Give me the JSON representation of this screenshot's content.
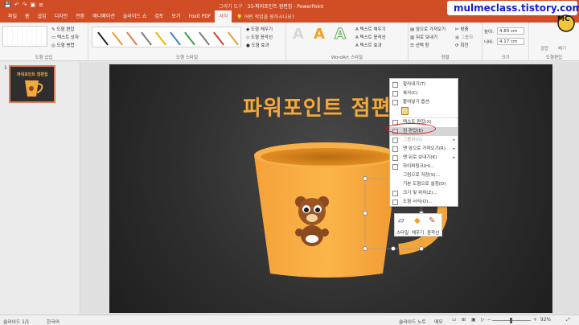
{
  "titlebar": {
    "context_tool": "그리기 도구",
    "doc_title": "33-파워포인트 점편집 - PowerPoint",
    "qat": [
      "💾",
      "↶",
      "↷",
      "▣",
      "≡"
    ]
  },
  "tabs": [
    {
      "label": "파일",
      "active": false
    },
    {
      "label": "홈",
      "active": false
    },
    {
      "label": "삽입",
      "active": false
    },
    {
      "label": "디자인",
      "active": false
    },
    {
      "label": "전환",
      "active": false
    },
    {
      "label": "애니메이션",
      "active": false
    },
    {
      "label": "슬라이드 쇼",
      "active": false
    },
    {
      "label": "검토",
      "active": false
    },
    {
      "label": "보기",
      "active": false
    },
    {
      "label": "Foxit PDF",
      "active": false
    },
    {
      "label": "서식",
      "active": true
    }
  ],
  "tell_me": "어떤 작업을 원하시나요?",
  "ribbon": {
    "insert_shapes": {
      "label": "도형 삽입",
      "edit_shape": "도형 편집",
      "text_box": "텍스트 상자",
      "merge_shapes": "도형 병합"
    },
    "shape_styles": {
      "label": "도형 스타일",
      "fill": "도형 채우기",
      "outline": "도형 윤곽선",
      "effects": "도형 효과",
      "swatch_colors": [
        "#222222",
        "#e69a2e",
        "#e07b3c",
        "#7d7d7d",
        "#f0b400",
        "#4a7fc1",
        "#3aa04a",
        "#7d7d7d",
        "#c44536",
        "#e0a030"
      ]
    },
    "wordart": {
      "label": "WordArt 스타일",
      "text_fill": "텍스트 채우기",
      "text_outline": "텍스트 윤곽선",
      "text_effects": "텍스트 효과",
      "sample_letter": "A"
    },
    "arrange": {
      "label": "정렬",
      "bring_forward": "앞으로 가져오기",
      "send_backward": "뒤로 보내기",
      "selection_pane": "선택 창",
      "align": "맞춤",
      "group": "그룹화",
      "rotate": "회전"
    },
    "size": {
      "label": "크기",
      "height_label": "높이:",
      "height_value": "4.83 cm",
      "width_label": "너비:",
      "width_value": "4.17 cm"
    },
    "shape_edit": {
      "label": "도형편집",
      "merge": "결합",
      "subtract": "빼기"
    }
  },
  "watermark": "mulmeclass.tistory.com",
  "thumbnails": [
    {
      "number": "1",
      "title": "파워포인트 점편집"
    }
  ],
  "slide": {
    "title": "파워포인트 점편"
  },
  "context_menu": [
    {
      "label": "잘라내기(T)",
      "enabled": true,
      "has_submenu": false,
      "highlighted": false
    },
    {
      "label": "복사(C)",
      "enabled": true,
      "has_submenu": false,
      "highlighted": false
    },
    {
      "label": "붙여넣기 옵션:",
      "enabled": true,
      "has_submenu": false,
      "highlighted": false
    },
    {
      "label": "텍스트 편집(X)",
      "enabled": true,
      "has_submenu": false,
      "highlighted": false
    },
    {
      "label": "점 편집(E)",
      "enabled": true,
      "has_submenu": false,
      "highlighted": true
    },
    {
      "label": "그룹화(G)",
      "enabled": false,
      "has_submenu": true,
      "highlighted": false
    },
    {
      "label": "맨 앞으로 가져오기(R)",
      "enabled": true,
      "has_submenu": true,
      "highlighted": false
    },
    {
      "label": "맨 뒤로 보내기(K)",
      "enabled": true,
      "has_submenu": true,
      "highlighted": false
    },
    {
      "label": "하이퍼링크(H)...",
      "enabled": true,
      "has_submenu": false,
      "highlighted": false
    },
    {
      "label": "그림으로 저장(S)...",
      "enabled": true,
      "has_submenu": false,
      "highlighted": false
    },
    {
      "label": "기본 도형으로 설정(D)",
      "enabled": true,
      "has_submenu": false,
      "highlighted": false
    },
    {
      "label": "크기 및 위치(Z)...",
      "enabled": true,
      "has_submenu": false,
      "highlighted": false
    },
    {
      "label": "도형 서식(O)...",
      "enabled": true,
      "has_submenu": false,
      "highlighted": false
    }
  ],
  "mini_toolbar": {
    "style": "스타일",
    "fill": "채우기",
    "outline": "윤곽선"
  },
  "statusbar": {
    "slide_info": "슬라이드 1/1",
    "language": "한국어",
    "notes": "슬라이드 노트",
    "comments": "메모",
    "zoom": "92%"
  },
  "colors": {
    "accent": "#d04d25",
    "cup": "#f6a93b",
    "highlight_ring": "#e8141b"
  }
}
